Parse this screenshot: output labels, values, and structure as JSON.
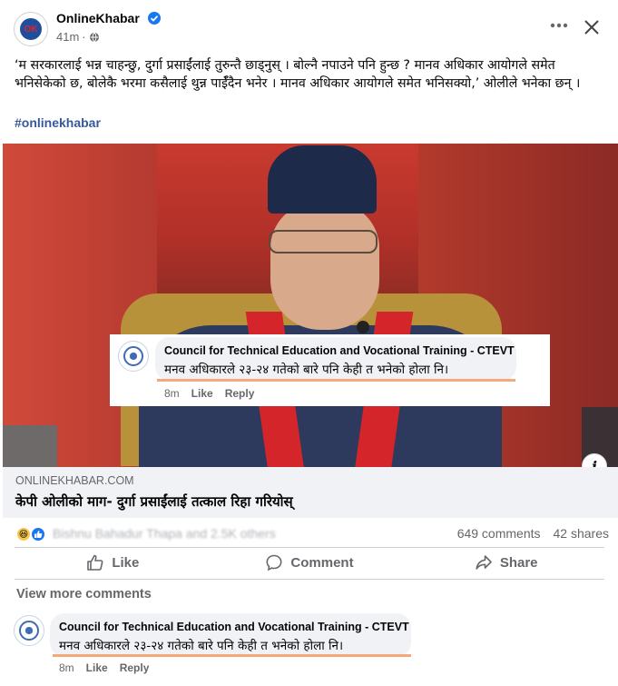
{
  "header": {
    "page_name": "OnlineKhabar",
    "timestamp": "41m",
    "logo_text": "OK",
    "more_icon": "more-dots-icon",
    "close_icon": "close-icon"
  },
  "post": {
    "text": "‘म सरकारलाई भन्न चाहन्छु, दुर्गा प्रसाईंलाई तुरुन्तै छाड्नुस् । बोल्नै नपाउने पनि हुन्छ ? मानव अधिकार आयोगले समेत भनिसेकेको छ, बोलेकै भरमा कसैलाई थुन्न पाईँदैन भनेर । मानव अधिकार आयोगले समेत भनिसक्यो,’ ओलीले भनेका छन् ।",
    "hashtag": "#onlinekhabar"
  },
  "image_overlay_comment": {
    "author": "Council for Technical Education and Vocational Training - CTEVT",
    "text": "मनव अधिकारले २३-२४ गतेको बारे पनि केही त भनेको होला नि।",
    "time": "8m",
    "like_label": "Like",
    "reply_label": "Reply"
  },
  "link_preview": {
    "domain": "ONLINEKHABAR.COM",
    "title": "केपी ओलीको माग- दुर्गा प्रसाईंलाई तत्काल रिहा गरियोस्"
  },
  "reactions": {
    "reactors_text": "Bishnu Bahadur Thapa and 2.5K others",
    "comments_count": "649 comments",
    "shares_count": "42 shares"
  },
  "actions": {
    "like": "Like",
    "comment": "Comment",
    "share": "Share"
  },
  "view_more_comments": "View more comments",
  "bottom_comment": {
    "author": "Council for Technical Education and Vocational Training - CTEVT",
    "text": "मनव अधिकारले २३-२४ गतेको बारे पनि केही त भनेको होला नि।",
    "time": "8m",
    "like_label": "Like",
    "reply_label": "Reply"
  },
  "colors": {
    "accent": "#1877f2",
    "secondary_text": "#65676b",
    "bubble": "#f0f2f5",
    "highlight_underline": "#f5a87a"
  }
}
